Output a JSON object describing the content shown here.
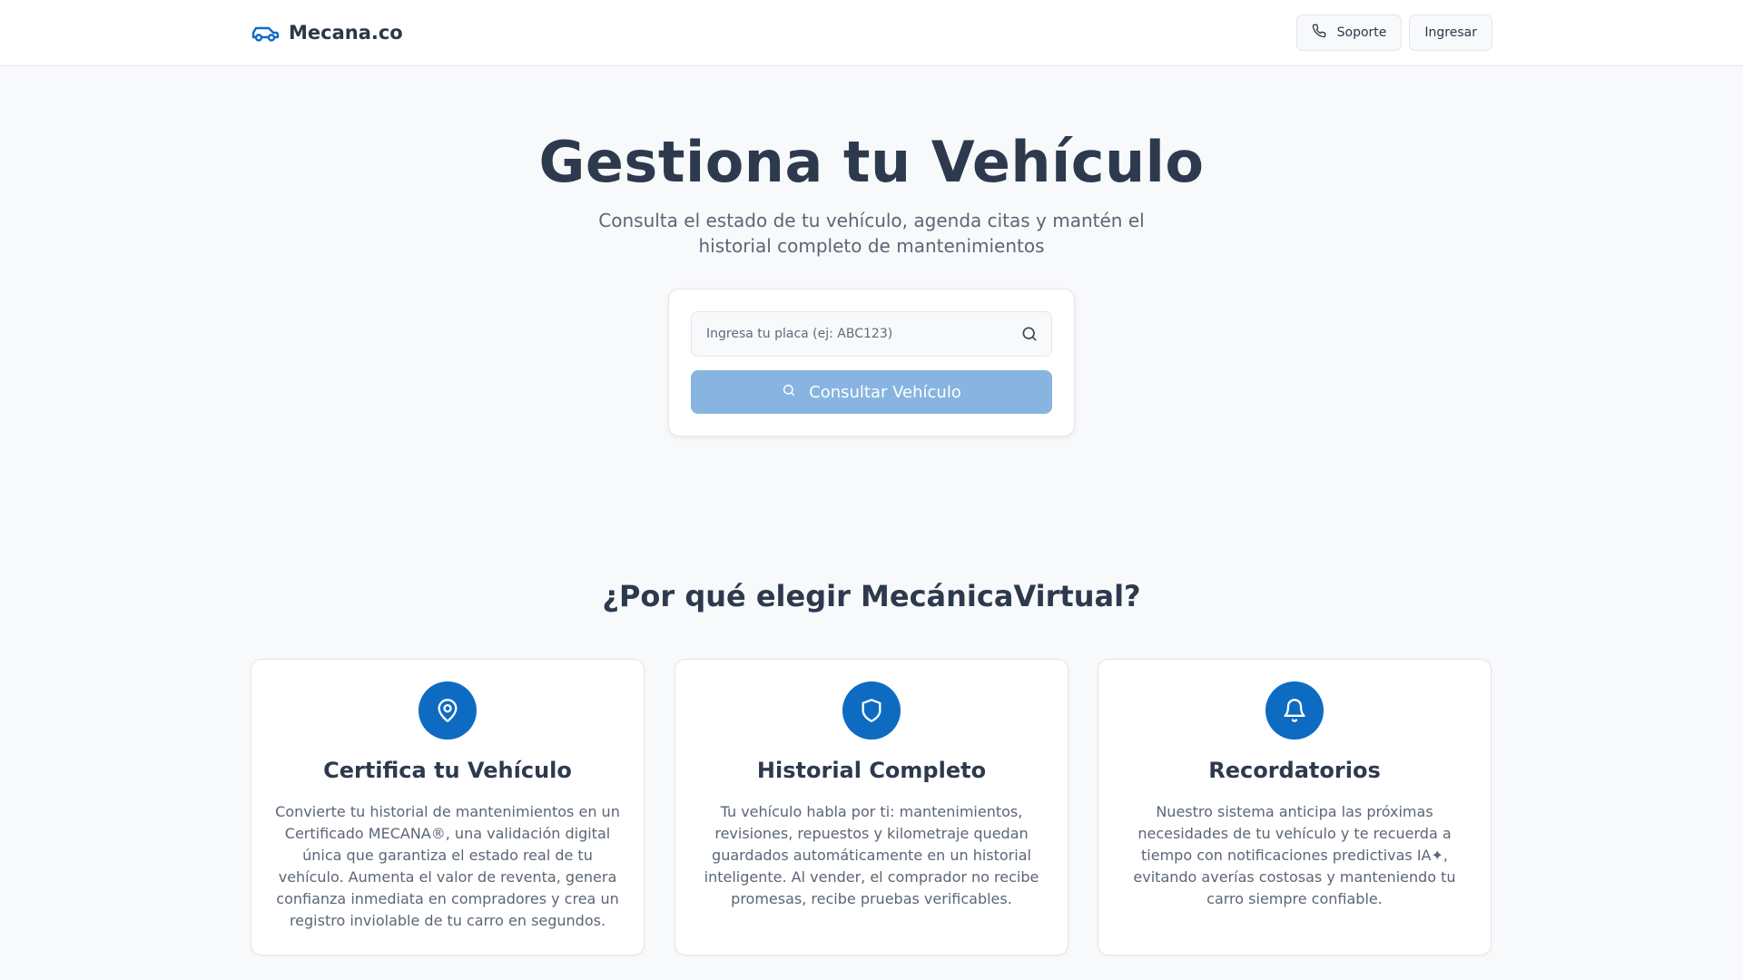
{
  "header": {
    "brand": "Mecana.co",
    "support_label": "Soporte",
    "login_label": "Ingresar",
    "brand_icon": "car-icon",
    "support_icon": "phone-icon"
  },
  "hero": {
    "title": "Gestiona tu Vehículo",
    "subtitle": "Consulta el estado de tu vehículo, agenda citas y mantén el historial completo de mantenimientos"
  },
  "search": {
    "placeholder": "Ingresa tu placa (ej: ABC123)",
    "value": "",
    "button_label": "Consultar Vehículo",
    "icon": "search-icon"
  },
  "features": {
    "title": "¿Por qué elegir MecánicaVirtual?",
    "items": [
      {
        "icon": "map-pin-icon",
        "title": "Certifica tu Vehículo",
        "description": "Convierte tu historial de mantenimientos en un Certificado MECANA®, una validación digital única que garantiza el estado real de tu vehículo. Aumenta el valor de reventa, genera confianza inmediata en compradores y crea un registro inviolable de tu carro en segundos."
      },
      {
        "icon": "shield-icon",
        "title": "Historial Completo",
        "description": "Tu vehículo habla por ti: mantenimientos, revisiones, repuestos y kilometraje quedan guardados automáticamente en un historial inteligente. Al vender, el comprador no recibe promesas, recibe pruebas verificables."
      },
      {
        "icon": "bell-icon",
        "title": "Recordatorios",
        "description": "Nuestro sistema anticipa las próximas necesidades de tu vehículo y te recuerda a tiempo con notificaciones predictivas IA✦, evitando averías costosas y manteniendo tu carro siempre confiable."
      }
    ]
  },
  "colors": {
    "accent": "#0e6bc2",
    "button_disabled": "#87b4e0",
    "text_dark": "#2d3a4e",
    "text_muted": "#5b6676"
  }
}
